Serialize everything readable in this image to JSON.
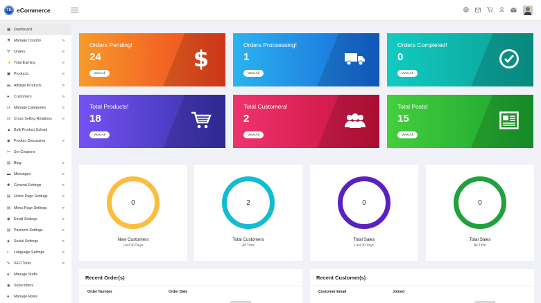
{
  "header": {
    "brand_logo_text": "TE",
    "brand_name": "eCommerce",
    "icons": [
      "globe-icon",
      "mail-icon",
      "cart-icon",
      "user-icon",
      "inbox-icon",
      "avatar"
    ]
  },
  "sidebar": {
    "items": [
      {
        "label": "Dashboard",
        "icon": "dashboard-icon",
        "chevron": false,
        "active": true
      },
      {
        "label": "Manage Country",
        "icon": "flag-icon",
        "chevron": true
      },
      {
        "label": "Orders",
        "icon": "orders-icon",
        "chevron": true
      },
      {
        "label": "Total Earning",
        "icon": "earning-icon",
        "chevron": true
      },
      {
        "label": "Products",
        "icon": "products-icon",
        "chevron": true
      },
      {
        "label": "Affiliate Products",
        "icon": "affiliate-icon",
        "chevron": true
      },
      {
        "label": "Customers",
        "icon": "customers-icon",
        "chevron": true
      },
      {
        "label": "Manage Categories",
        "icon": "categories-icon",
        "chevron": true
      },
      {
        "label": "Cross Selling Relations",
        "icon": "relations-icon",
        "chevron": true
      },
      {
        "label": "Bulk Product Upload",
        "icon": "upload-icon",
        "chevron": false
      },
      {
        "label": "Product Discussion",
        "icon": "discussion-icon",
        "chevron": true
      },
      {
        "label": "Set Coupons",
        "icon": "coupon-icon",
        "chevron": false
      },
      {
        "label": "Blog",
        "icon": "blog-icon",
        "chevron": true
      },
      {
        "label": "Messages",
        "icon": "messages-icon",
        "chevron": true
      },
      {
        "label": "General Settings",
        "icon": "settings-icon",
        "chevron": true
      },
      {
        "label": "Home Page Settings",
        "icon": "home-page-icon",
        "chevron": true
      },
      {
        "label": "Menu Page Settings",
        "icon": "menu-page-icon",
        "chevron": true
      },
      {
        "label": "Email Settings",
        "icon": "email-icon",
        "chevron": true
      },
      {
        "label": "Payment Settings",
        "icon": "payment-icon",
        "chevron": true
      },
      {
        "label": "Social Settings",
        "icon": "social-icon",
        "chevron": true
      },
      {
        "label": "Language Settings",
        "icon": "language-icon",
        "chevron": true
      },
      {
        "label": "SEO Tools",
        "icon": "seo-icon",
        "chevron": true
      },
      {
        "label": "Manage Staffs",
        "icon": "staff-icon",
        "chevron": false
      },
      {
        "label": "Subscribers",
        "icon": "subscribers-icon",
        "chevron": false
      },
      {
        "label": "Manage Roles",
        "icon": "roles-icon",
        "chevron": false
      }
    ]
  },
  "cards": [
    {
      "title": "Orders Pending!",
      "value": "24",
      "button": "View All",
      "icon": "dollar-icon",
      "colors": [
        "#f79a2b",
        "#ef3f1d"
      ]
    },
    {
      "title": "Orders Procsessing!",
      "value": "1",
      "button": "View All",
      "icon": "truck-icon",
      "colors": [
        "#2cb3ef",
        "#1565d8"
      ]
    },
    {
      "title": "Orders Completed!",
      "value": "0",
      "button": "View All",
      "icon": "check-circle-icon",
      "colors": [
        "#12cbc2",
        "#0a9e93"
      ]
    },
    {
      "title": "Total Products!",
      "value": "18",
      "button": "View All",
      "icon": "cart-icon",
      "colors": [
        "#7552f2",
        "#3530a8"
      ]
    },
    {
      "title": "Total Customers!",
      "value": "2",
      "button": "View All",
      "icon": "users-icon",
      "colors": [
        "#f0336e",
        "#c6103a"
      ]
    },
    {
      "title": "Total Posts!",
      "value": "15",
      "button": "View All",
      "icon": "newspaper-icon",
      "colors": [
        "#44cf3e",
        "#1aa12c"
      ]
    }
  ],
  "circles": [
    {
      "value": "0",
      "label": "New Customers",
      "sub": "Last 30 Days",
      "color": "#fcbc3e"
    },
    {
      "value": "2",
      "label": "Total Customers",
      "sub": "All Time",
      "color": "#12bcd2"
    },
    {
      "value": "0",
      "label": "Total Sales",
      "sub": "Last 30 days",
      "color": "#5b20c0"
    },
    {
      "value": "0",
      "label": "Total Sales",
      "sub": "All Time",
      "color": "#1fa13c"
    }
  ],
  "recent_orders": {
    "title": "Recent Order(s)",
    "columns": [
      "Order Number",
      "Order Date"
    ]
  },
  "recent_customers": {
    "title": "Recent Customer(s)",
    "columns": [
      "Customer Email",
      "Joined"
    ]
  }
}
